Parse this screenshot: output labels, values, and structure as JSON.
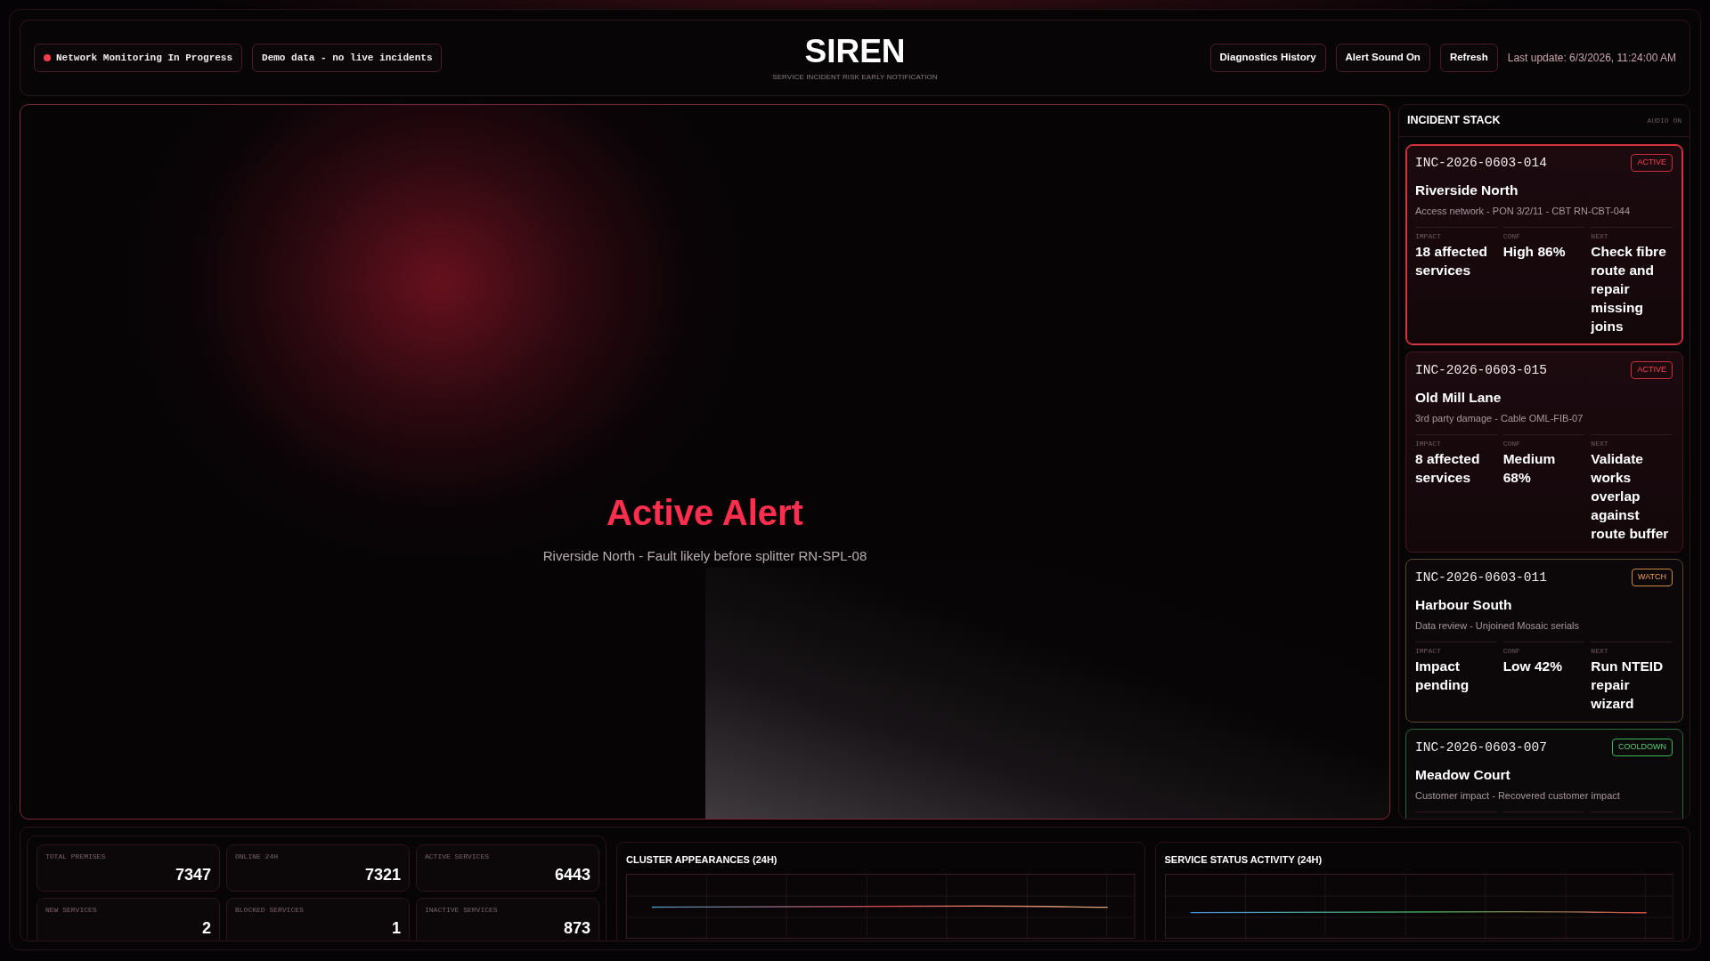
{
  "header": {
    "pills": [
      {
        "kind": "live",
        "label": "Network Monitoring In Progress"
      },
      {
        "kind": "note",
        "label": "Demo data - no live incidents"
      }
    ],
    "title": "SIREN",
    "subtitle": "SERVICE INCIDENT RISK EARLY NOTIFICATION",
    "buttons": [
      "Diagnostics History",
      "Alert Sound On",
      "Refresh"
    ],
    "last_update": "Last update: 6/3/2026, 11:24:00 AM"
  },
  "alert": {
    "title": "Active Alert",
    "message": "Riverside North - Fault likely before splitter RN-SPL-08"
  },
  "incident_stack": {
    "title": "INCIDENT STACK",
    "audio": "AUDIO ON",
    "incidents": [
      {
        "id": "INC-2026-0603-014",
        "status": "ACTIVE",
        "kind": "active",
        "selected": true,
        "name": "Riverside North",
        "detail": "Access network - PON 3/2/11 - CBT RN-CBT-044",
        "metrics": [
          {
            "label": "IMPACT",
            "value": "18 affected services"
          },
          {
            "label": "CONF",
            "value": "High 86%"
          },
          {
            "label": "NEXT",
            "value": "Check fibre route and repair missing joins"
          }
        ]
      },
      {
        "id": "INC-2026-0603-015",
        "status": "ACTIVE",
        "kind": "active",
        "selected": false,
        "name": "Old Mill Lane",
        "detail": "3rd party damage - Cable OML-FIB-07",
        "metrics": [
          {
            "label": "IMPACT",
            "value": "8 affected services"
          },
          {
            "label": "CONF",
            "value": "Medium 68%"
          },
          {
            "label": "NEXT",
            "value": "Validate works overlap against route buffer"
          }
        ]
      },
      {
        "id": "INC-2026-0603-011",
        "status": "WATCH",
        "kind": "watch",
        "selected": false,
        "name": "Harbour South",
        "detail": "Data review - Unjoined Mosaic serials",
        "metrics": [
          {
            "label": "IMPACT",
            "value": "Impact pending"
          },
          {
            "label": "CONF",
            "value": "Low 42%"
          },
          {
            "label": "NEXT",
            "value": "Run NTEID repair wizard"
          }
        ]
      },
      {
        "id": "INC-2026-0603-007",
        "status": "COOLDOWN",
        "kind": "cooldown",
        "selected": false,
        "name": "Meadow Court",
        "detail": "Customer impact - Recovered customer impact"
      }
    ]
  },
  "stats": [
    {
      "label": "TOTAL PREMISES",
      "value": "7347"
    },
    {
      "label": "ONLINE 24H",
      "value": "7321"
    },
    {
      "label": "ACTIVE SERVICES",
      "value": "6443"
    },
    {
      "label": "NEW SERVICES",
      "value": "2"
    },
    {
      "label": "BLOCKED SERVICES",
      "value": "1"
    },
    {
      "label": "INACTIVE SERVICES",
      "value": "873"
    }
  ],
  "charts": [
    {
      "kind": "cluster",
      "title": "CLUSTER APPEARANCES (24H)"
    },
    {
      "kind": "status",
      "title": "SERVICE STATUS ACTIVITY (24H)"
    }
  ]
}
